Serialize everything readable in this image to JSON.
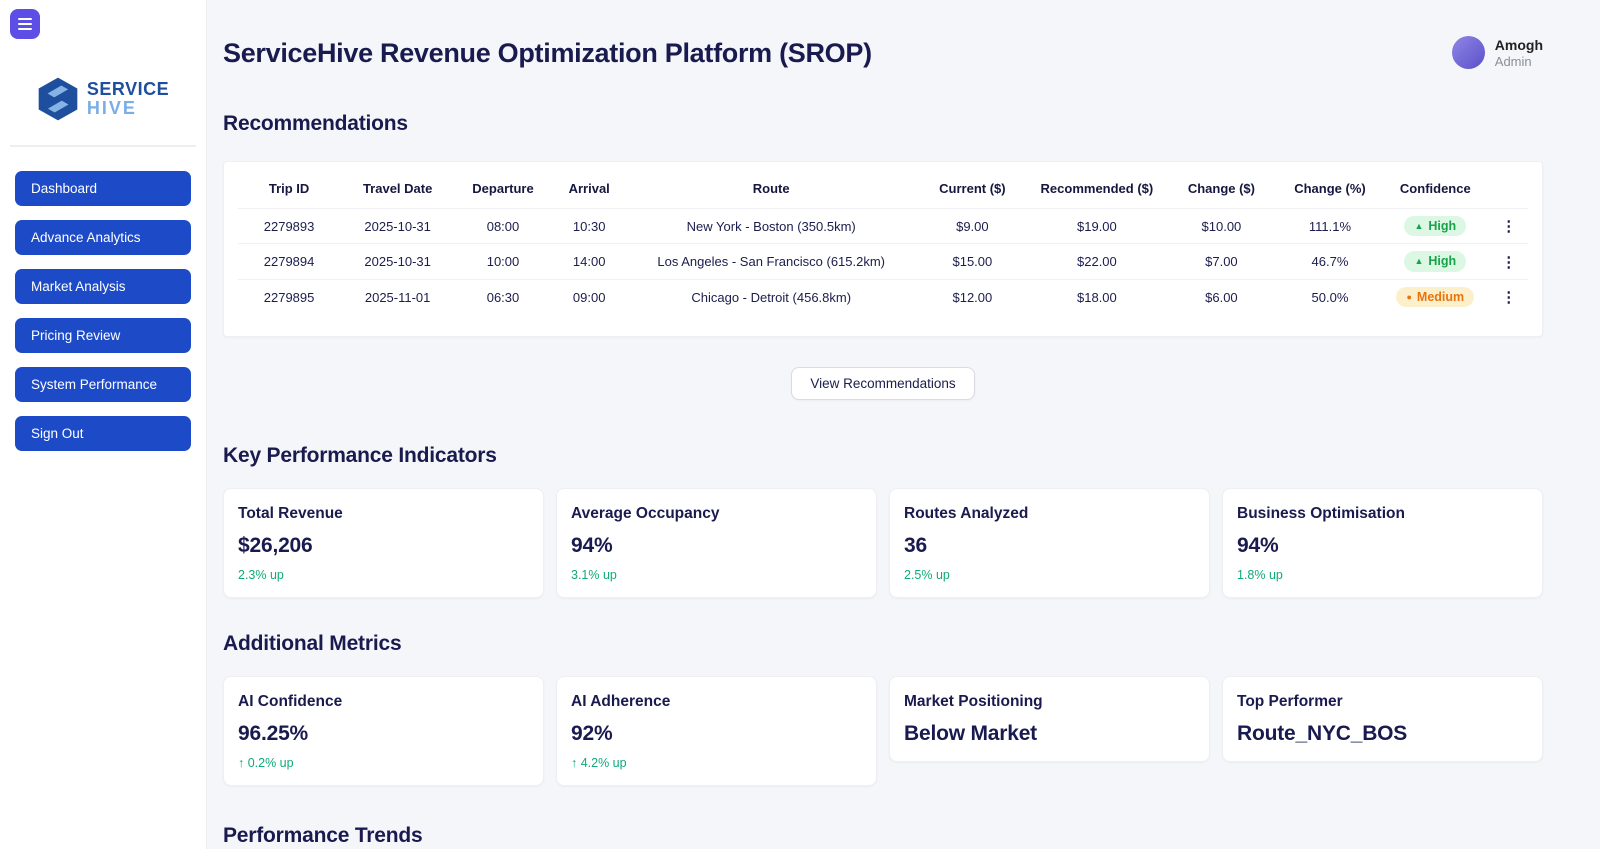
{
  "app": {
    "title": "ServiceHive Revenue Optimization Platform (SROP)",
    "user": {
      "name": "Amogh",
      "role": "Admin"
    }
  },
  "logo": {
    "line1": "SERVICE",
    "line2": "HIVE"
  },
  "sidebar": {
    "items": [
      {
        "label": "Dashboard"
      },
      {
        "label": "Advance Analytics"
      },
      {
        "label": "Market Analysis"
      },
      {
        "label": "Pricing Review"
      },
      {
        "label": "System Performance"
      },
      {
        "label": "Sign Out"
      }
    ]
  },
  "recommendations": {
    "heading": "Recommendations",
    "columns": [
      "Trip ID",
      "Travel Date",
      "Departure",
      "Arrival",
      "Route",
      "Current ($)",
      "Recommended ($)",
      "Change ($)",
      "Change (%)",
      "Confidence",
      ""
    ],
    "rows": [
      {
        "trip_id": "2279893",
        "travel_date": "2025-10-31",
        "departure": "08:00",
        "arrival": "10:30",
        "route": "New York - Boston (350.5km)",
        "current": "$9.00",
        "recommended": "$19.00",
        "change_usd": "$10.00",
        "change_pct": "111.1%",
        "confidence": "High",
        "confidence_icon": "▲",
        "menu_icon": "⋮"
      },
      {
        "trip_id": "2279894",
        "travel_date": "2025-10-31",
        "departure": "10:00",
        "arrival": "14:00",
        "route": "Los Angeles - San Francisco (615.2km)",
        "current": "$15.00",
        "recommended": "$22.00",
        "change_usd": "$7.00",
        "change_pct": "46.7%",
        "confidence": "High",
        "confidence_icon": "▲",
        "menu_icon": "⋮"
      },
      {
        "trip_id": "2279895",
        "travel_date": "2025-11-01",
        "departure": "06:30",
        "arrival": "09:00",
        "route": "Chicago - Detroit (456.8km)",
        "current": "$12.00",
        "recommended": "$18.00",
        "change_usd": "$6.00",
        "change_pct": "50.0%",
        "confidence": "Medium",
        "confidence_icon": "●",
        "menu_icon": "⋮"
      }
    ],
    "view_button": "View Recommendations"
  },
  "kpi": {
    "heading": "Key Performance Indicators",
    "cards": [
      {
        "title": "Total Revenue",
        "value": "$26,206",
        "change": "2.3% up"
      },
      {
        "title": "Average Occupancy",
        "value": "94%",
        "change": "3.1% up"
      },
      {
        "title": "Routes Analyzed",
        "value": "36",
        "change": "2.5% up"
      },
      {
        "title": "Business Optimisation",
        "value": "94%",
        "change": "1.8% up"
      }
    ]
  },
  "additional": {
    "heading": "Additional Metrics",
    "cards": [
      {
        "title": "AI Confidence",
        "value": "96.25%",
        "change": "↑ 0.2% up"
      },
      {
        "title": "AI Adherence",
        "value": "92%",
        "change": "↑ 4.2% up"
      },
      {
        "title": "Market Positioning",
        "value": "Below Market",
        "change": ""
      },
      {
        "title": "Top Performer",
        "value": "Route_NYC_BOS",
        "change": ""
      }
    ]
  },
  "trends": {
    "heading": "Performance Trends"
  },
  "colors": {
    "sidebar_button_blue": "#1d4bc8",
    "hamburger_purple": "#5d4ee6",
    "heading_navy": "#191a4e",
    "badge_high_text": "#18a34a",
    "badge_high_bg": "#dcf7e4",
    "badge_medium_text": "#e8740e",
    "badge_medium_bg": "#fcf0cc",
    "change_green": "#10a97a",
    "logo_dark_blue": "#1e4f9e",
    "logo_light_blue": "#79aee6",
    "main_background": "#f5f6fa"
  }
}
